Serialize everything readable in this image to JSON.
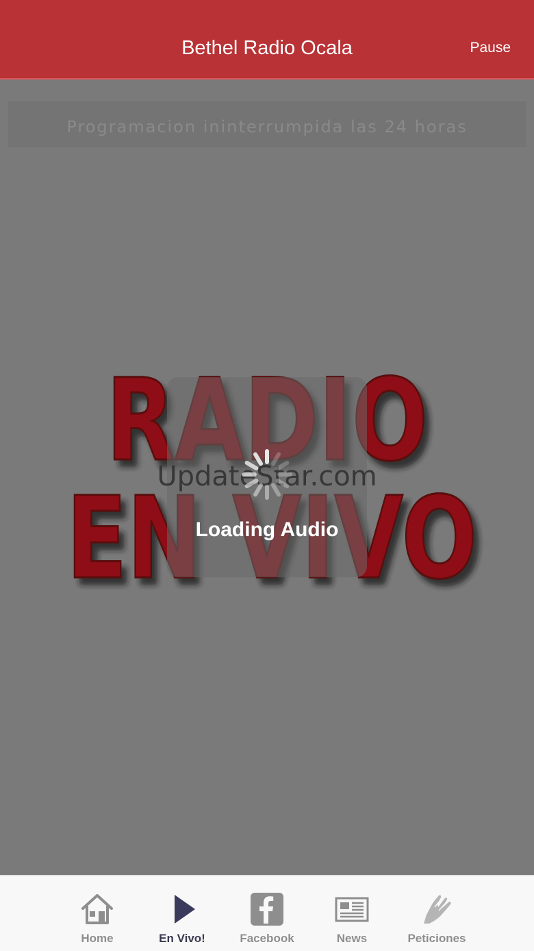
{
  "header": {
    "title": "Bethel Radio Ocala",
    "pause_label": "Pause",
    "background_color": "#b83236"
  },
  "marquee": {
    "text": "Programacion ininterrumpida las 24 horas"
  },
  "logo": {
    "line1": "RADIO",
    "line2": "EN VIVO",
    "color": "#8e0e14"
  },
  "loading": {
    "watermark": "UpdateStar.com",
    "text": "Loading Audio"
  },
  "tabbar": {
    "items": [
      {
        "label": "Home",
        "icon": "home-icon"
      },
      {
        "label": "En Vivo!",
        "icon": "play-icon",
        "active": true
      },
      {
        "label": "Facebook",
        "icon": "facebook-icon"
      },
      {
        "label": "News",
        "icon": "newspaper-icon"
      },
      {
        "label": "Peticiones",
        "icon": "praying-hands-icon"
      }
    ]
  }
}
